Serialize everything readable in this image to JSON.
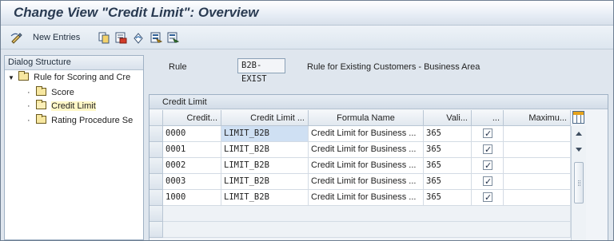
{
  "window": {
    "title": "Change View \"Credit Limit\": Overview"
  },
  "toolbar": {
    "new_entries_label": "New Entries",
    "icons": [
      "edit-pen-icon",
      "copy-icon",
      "delete-icon",
      "undo-icon",
      "select-all-icon",
      "deselect-icon"
    ]
  },
  "dialog_structure": {
    "header": "Dialog Structure",
    "items": [
      {
        "label": "Rule for Scoring and Cre",
        "level": 0
      },
      {
        "label": "Score",
        "level": 1
      },
      {
        "label": "Credit Limit",
        "level": 1
      },
      {
        "label": "Rating Procedure Se",
        "level": 1
      }
    ]
  },
  "rule": {
    "label": "Rule",
    "value": "B2B-EXIST",
    "description": "Rule for Existing Customers - Business Area"
  },
  "grid": {
    "title": "Credit Limit",
    "columns": [
      "Credit...",
      "Credit Limit ...",
      "Formula Name",
      "Vali...",
      "...",
      "Maximu..."
    ],
    "rows": [
      {
        "credit": "0000",
        "limit": "LIMIT_B2B",
        "formula": "Credit Limit for Business ...",
        "validity": "365",
        "checked": true,
        "maximum": ""
      },
      {
        "credit": "0001",
        "limit": "LIMIT_B2B",
        "formula": "Credit Limit for Business ...",
        "validity": "365",
        "checked": true,
        "maximum": ""
      },
      {
        "credit": "0002",
        "limit": "LIMIT_B2B",
        "formula": "Credit Limit for Business ...",
        "validity": "365",
        "checked": true,
        "maximum": ""
      },
      {
        "credit": "0003",
        "limit": "LIMIT_B2B",
        "formula": "Credit Limit for Business ...",
        "validity": "365",
        "checked": true,
        "maximum": ""
      },
      {
        "credit": "1000",
        "limit": "LIMIT_B2B",
        "formula": "Credit Limit for Business ...",
        "validity": "365",
        "checked": true,
        "maximum": ""
      }
    ]
  }
}
